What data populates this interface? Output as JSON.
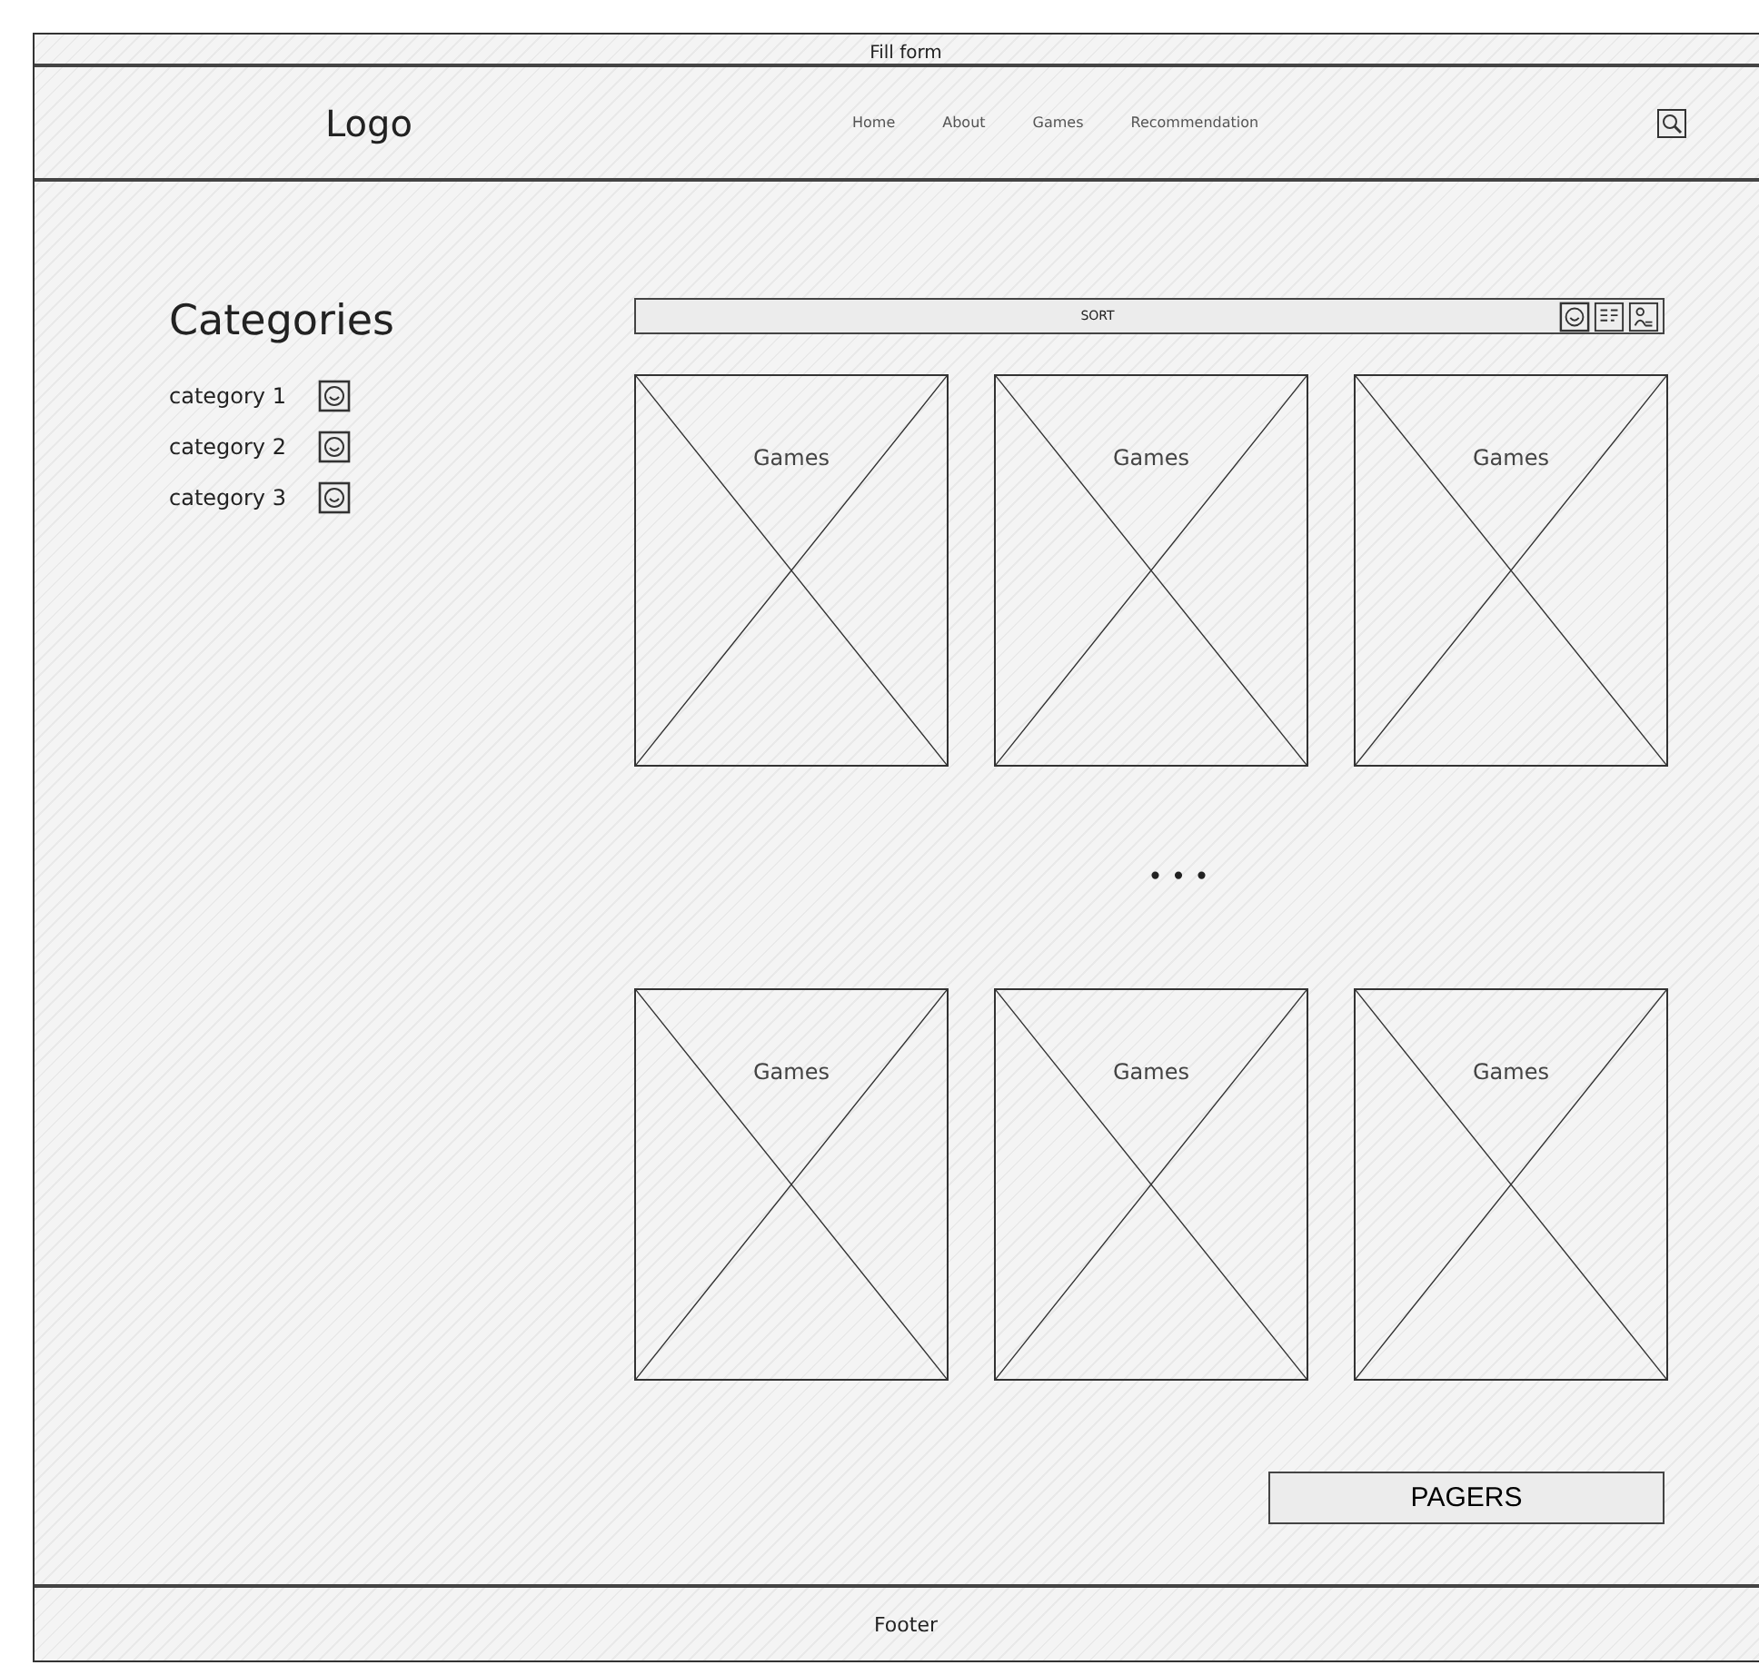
{
  "window": {
    "title": "Fill form"
  },
  "header": {
    "logo": "Logo",
    "nav": [
      {
        "label": "Home"
      },
      {
        "label": "About"
      },
      {
        "label": "Games"
      },
      {
        "label": "Recommendation"
      }
    ]
  },
  "sidebar": {
    "title": "Categories",
    "items": [
      {
        "label": "category 1"
      },
      {
        "label": "category 2"
      },
      {
        "label": "category 3"
      }
    ]
  },
  "sort_bar": {
    "label": "SORT"
  },
  "games_top": [
    {
      "title": "Games"
    },
    {
      "title": "Games"
    },
    {
      "title": "Games"
    }
  ],
  "more": "• • •",
  "games_bottom": [
    {
      "title": "Games"
    },
    {
      "title": "Games"
    },
    {
      "title": "Games"
    }
  ],
  "pager": {
    "label": "PAGERS"
  },
  "footer": {
    "text": "Footer"
  }
}
